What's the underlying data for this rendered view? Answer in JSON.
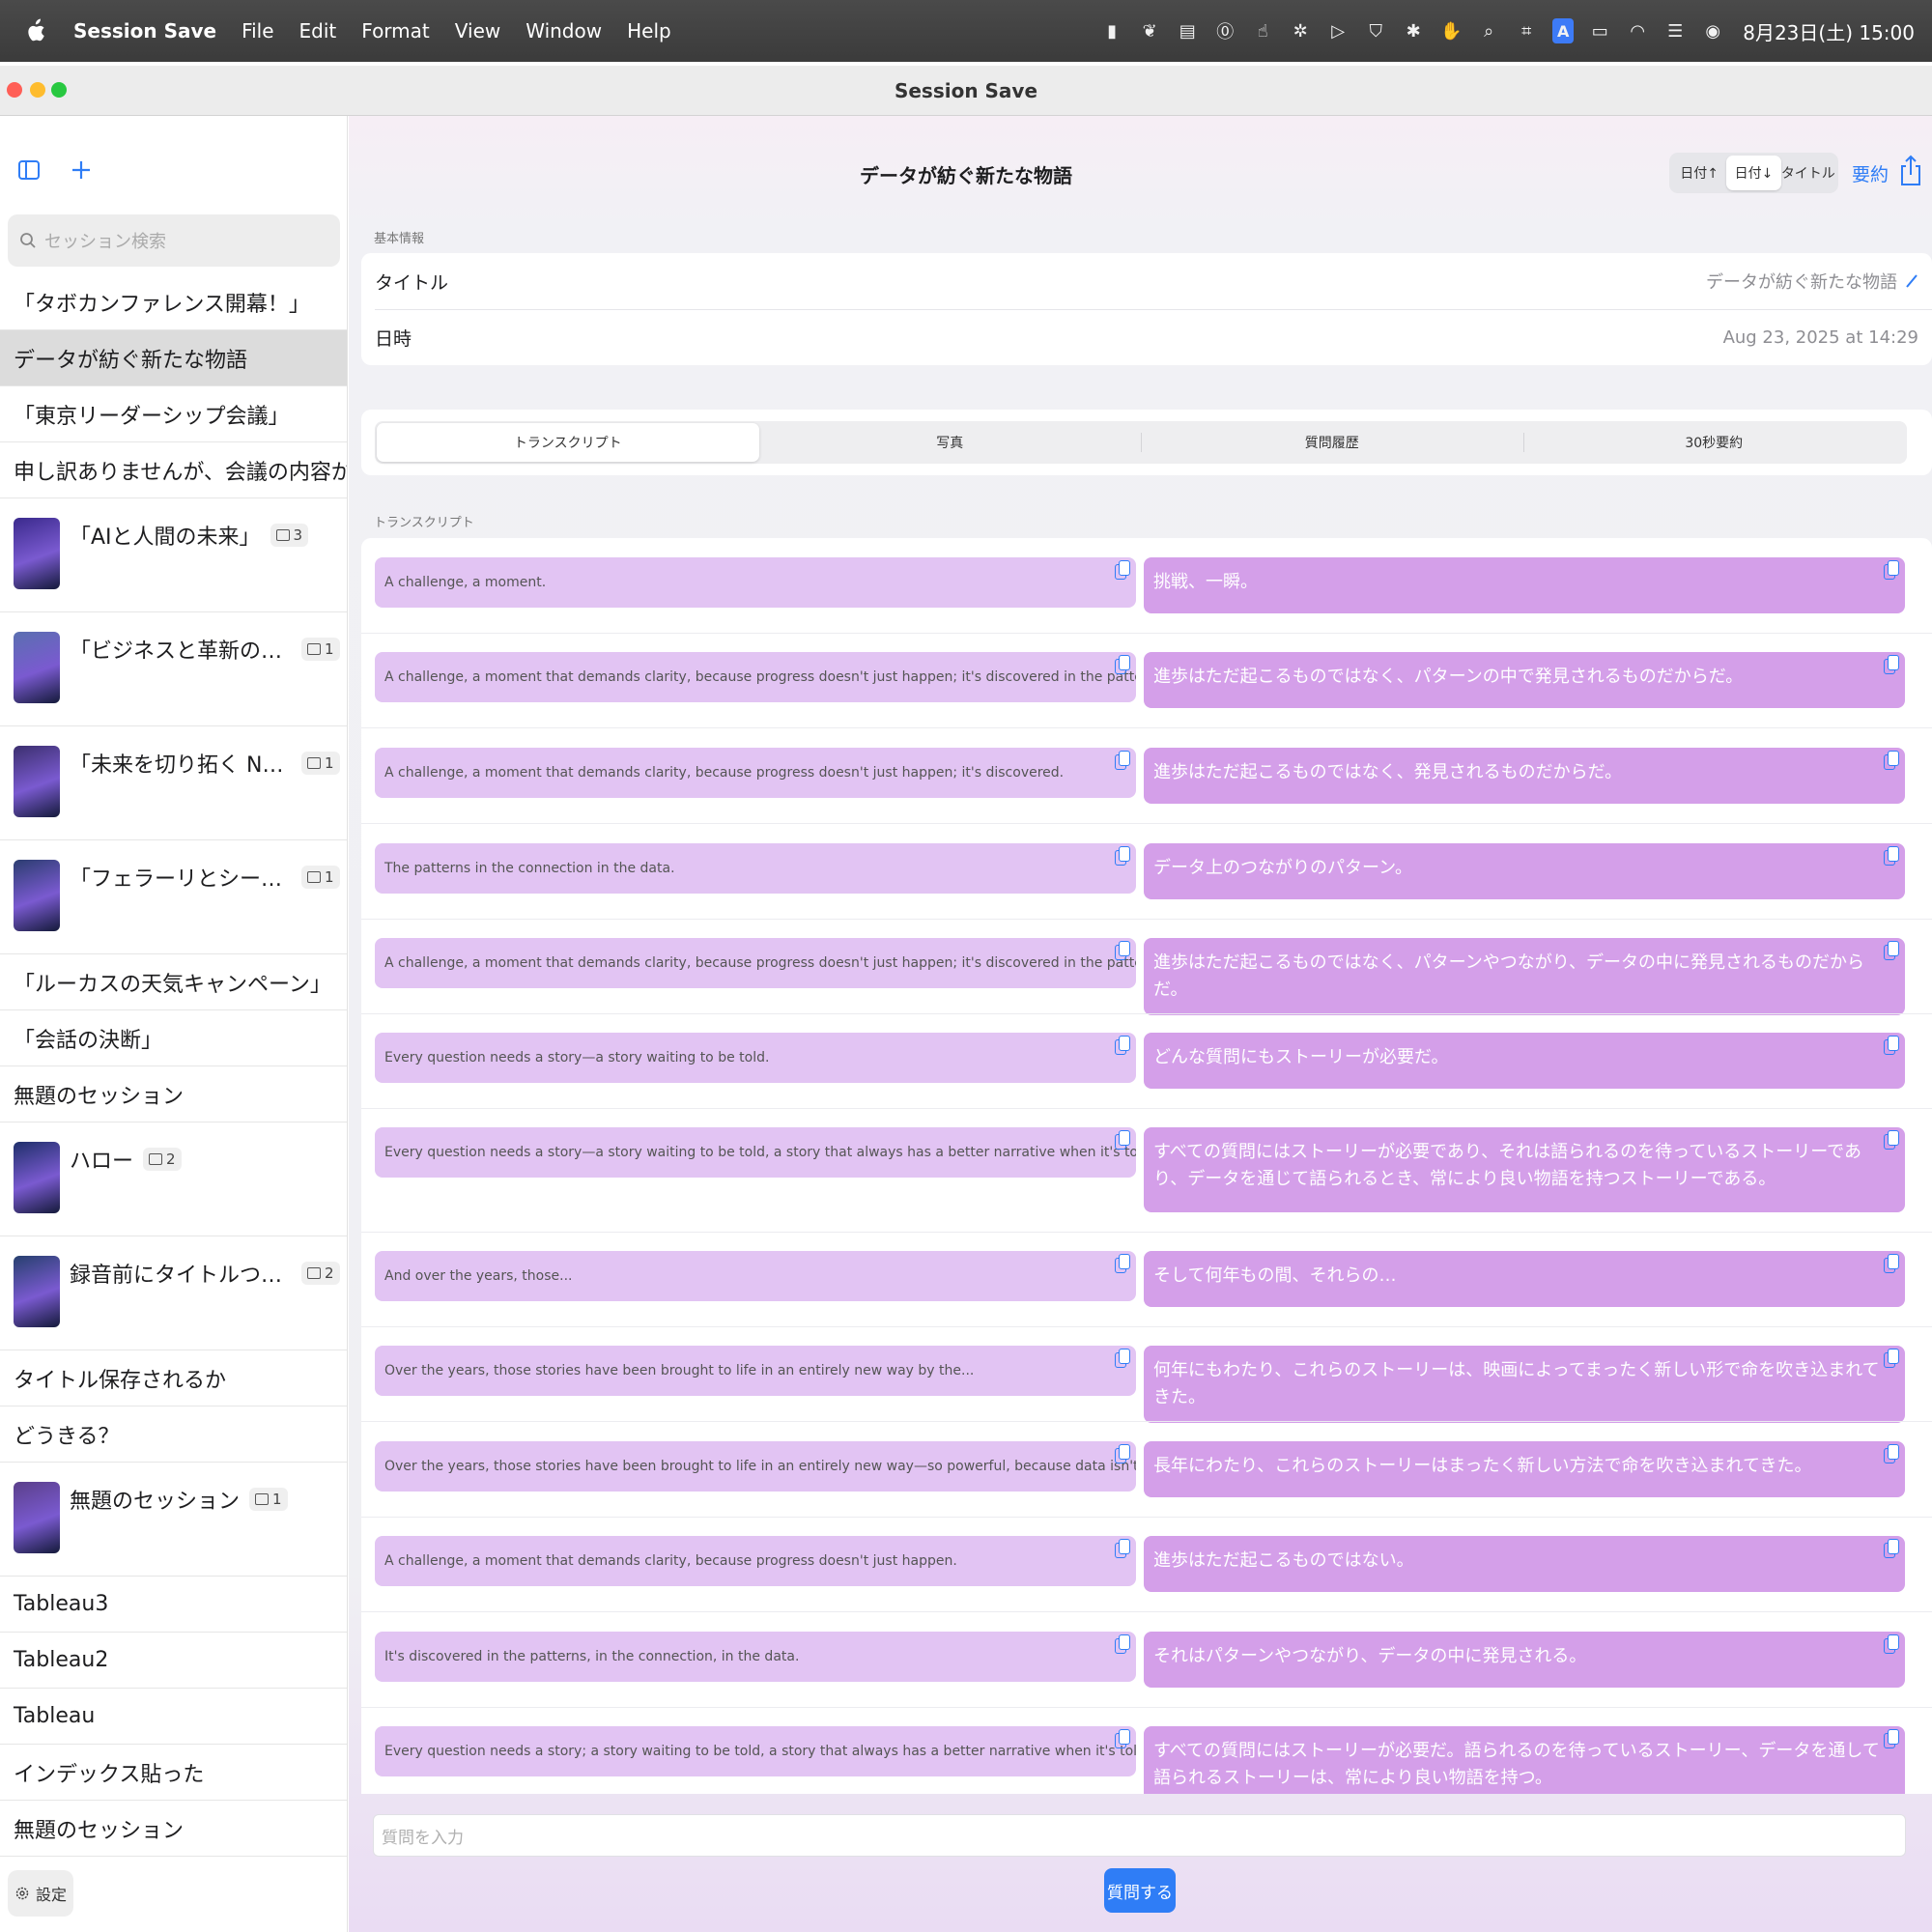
{
  "menubar": {
    "app_name": "Session Save",
    "menus": [
      "File",
      "Edit",
      "Format",
      "View",
      "Window",
      "Help"
    ],
    "status_icons": [
      "scanner-icon",
      "plant-icon",
      "clipboard-icon",
      "one-password-icon",
      "hand-pointer-icon",
      "bug-icon",
      "play-icon",
      "shield-icon",
      "bluetooth-icon",
      "hand-icon",
      "search-icon",
      "tag-icon",
      "input-source-icon",
      "battery-icon",
      "wifi-icon",
      "control-center-icon",
      "siri-icon"
    ],
    "input_source_label": "A",
    "clock": "8月23日(土) 15:00"
  },
  "window": {
    "title": "Session Save"
  },
  "sidebar": {
    "search_placeholder": "セッション検索",
    "settings_label": "設定",
    "items": [
      {
        "label": "「タボカンファレンス開幕！」",
        "thumb": false
      },
      {
        "label": "データが紡ぐ新たな物語",
        "thumb": false,
        "selected": true
      },
      {
        "label": "「東京リーダーシップ会議」",
        "thumb": false
      },
      {
        "label": "申し訳ありませんが、会議の内容が提供さ…",
        "thumb": false
      },
      {
        "label": "「AIと人間の未来」",
        "thumb": true,
        "badge": "3",
        "thumb_color": "#3a2a8c"
      },
      {
        "label": "「ビジネスと革新の融合」",
        "thumb": true,
        "badge": "1",
        "thumb_color": "#5a6fb0"
      },
      {
        "label": "「未来を切り拓く Next」",
        "thumb": true,
        "badge": "1",
        "thumb_color": "#3b2f6e"
      },
      {
        "label": "「フェラーリとシーランの新提…",
        "thumb": true,
        "badge": "1",
        "thumb_color": "#2b3d70"
      },
      {
        "label": "「ルーカスの天気キャンペーン」",
        "thumb": false
      },
      {
        "label": "「会話の決断」",
        "thumb": false
      },
      {
        "label": "無題のセッション",
        "thumb": false
      },
      {
        "label": "ハロー",
        "thumb": true,
        "badge": "2",
        "thumb_color": "#1e2f6a"
      },
      {
        "label": "録音前にタイトルつける",
        "thumb": true,
        "badge": "2",
        "thumb_color": "#26406e"
      },
      {
        "label": "タイトル保存されるか",
        "thumb": false
      },
      {
        "label": "どうきる？",
        "thumb": false
      },
      {
        "label": "無題のセッション",
        "thumb": true,
        "badge": "1",
        "thumb_color": "#5a3f8a"
      },
      {
        "label": "Tableau3",
        "thumb": false
      },
      {
        "label": "Tableau2",
        "thumb": false
      },
      {
        "label": "Tableau",
        "thumb": false
      },
      {
        "label": "インデックス貼った",
        "thumb": false
      },
      {
        "label": "無題のセッション",
        "thumb": false
      }
    ]
  },
  "main": {
    "title": "データが紡ぐ新たな物語",
    "sort_options": [
      "日付↑",
      "日付↓",
      "タイトル"
    ],
    "sort_selected": "日付↓",
    "summary_label": "要約",
    "basic_info_label": "基本情報",
    "title_field_label": "タイトル",
    "title_field_value": "データが紡ぐ新たな物語",
    "date_field_label": "日時",
    "date_field_value": "Aug 23, 2025 at 14:29",
    "tabs": [
      "トランスクリプト",
      "写真",
      "質問履歴",
      "30秒要約"
    ],
    "active_tab": "トランスクリプト",
    "transcript_label": "トランスクリプト",
    "transcript": [
      {
        "en": "A challenge, a moment.",
        "ja": "挑戦、一瞬。"
      },
      {
        "en": "A challenge, a moment that demands clarity, because progress doesn't just happen; it's discovered in the pattern.",
        "ja": "進歩はただ起こるものではなく、パターンの中で発見されるものだからだ。"
      },
      {
        "en": "A challenge, a moment that demands clarity, because progress doesn't just happen; it's discovered.",
        "ja": "進歩はただ起こるものではなく、発見されるものだからだ。"
      },
      {
        "en": "The patterns in the connection in the data.",
        "ja": "データ上のつながりのパターン。"
      },
      {
        "en": "A challenge, a moment that demands clarity, because progress doesn't just happen; it's discovered in the patterns, in the connection, in the data.",
        "ja": "進歩はただ起こるものではなく、パターンやつながり、データの中に発見されるものだからだ。"
      },
      {
        "en": "Every question needs a story—a story waiting to be told.",
        "ja": "どんな質問にもストーリーが必要だ。"
      },
      {
        "en": "Every question needs a story—a story waiting to be told, a story that always has a better narrative when it's told through data.",
        "ja": "すべての質問にはストーリーが必要であり、それは語られるのを待っているストーリーであり、データを通じて語られるとき、常により良い物語を持つストーリーである。"
      },
      {
        "en": "And over the years, those...",
        "ja": "そして何年もの間、それらの…"
      },
      {
        "en": "Over the years, those stories have been brought to life in an entirely new way by the...",
        "ja": "何年にもわたり、これらのストーリーは、映画によってまったく新しい形で命を吹き込まれてきた。"
      },
      {
        "en": "Over the years, those stories have been brought to life in an entirely new way—so powerful, because data isn't just...",
        "ja": "長年にわたり、これらのストーリーはまったく新しい方法で命を吹き込まれてきた。"
      },
      {
        "en": "A challenge, a moment that demands clarity, because progress doesn't just happen.",
        "ja": "進歩はただ起こるものではない。"
      },
      {
        "en": "It's discovered in the patterns, in the connection, in the data.",
        "ja": "それはパターンやつながり、データの中に発見される。"
      },
      {
        "en": "Every question needs a story; a story waiting to be told, a story that always has a better narrative when it's told through data.",
        "ja": "すべての質問にはストーリーが必要だ。語られるのを待っているストーリー、データを通して語られるストーリーは、常により良い物語を持つ。"
      }
    ],
    "question_placeholder": "質問を入力",
    "ask_button_label": "質問する"
  },
  "colors": {
    "accent": "#2f7df6",
    "bubble_en": "#e2c4f3",
    "bubble_ja": "#d49fe9"
  }
}
